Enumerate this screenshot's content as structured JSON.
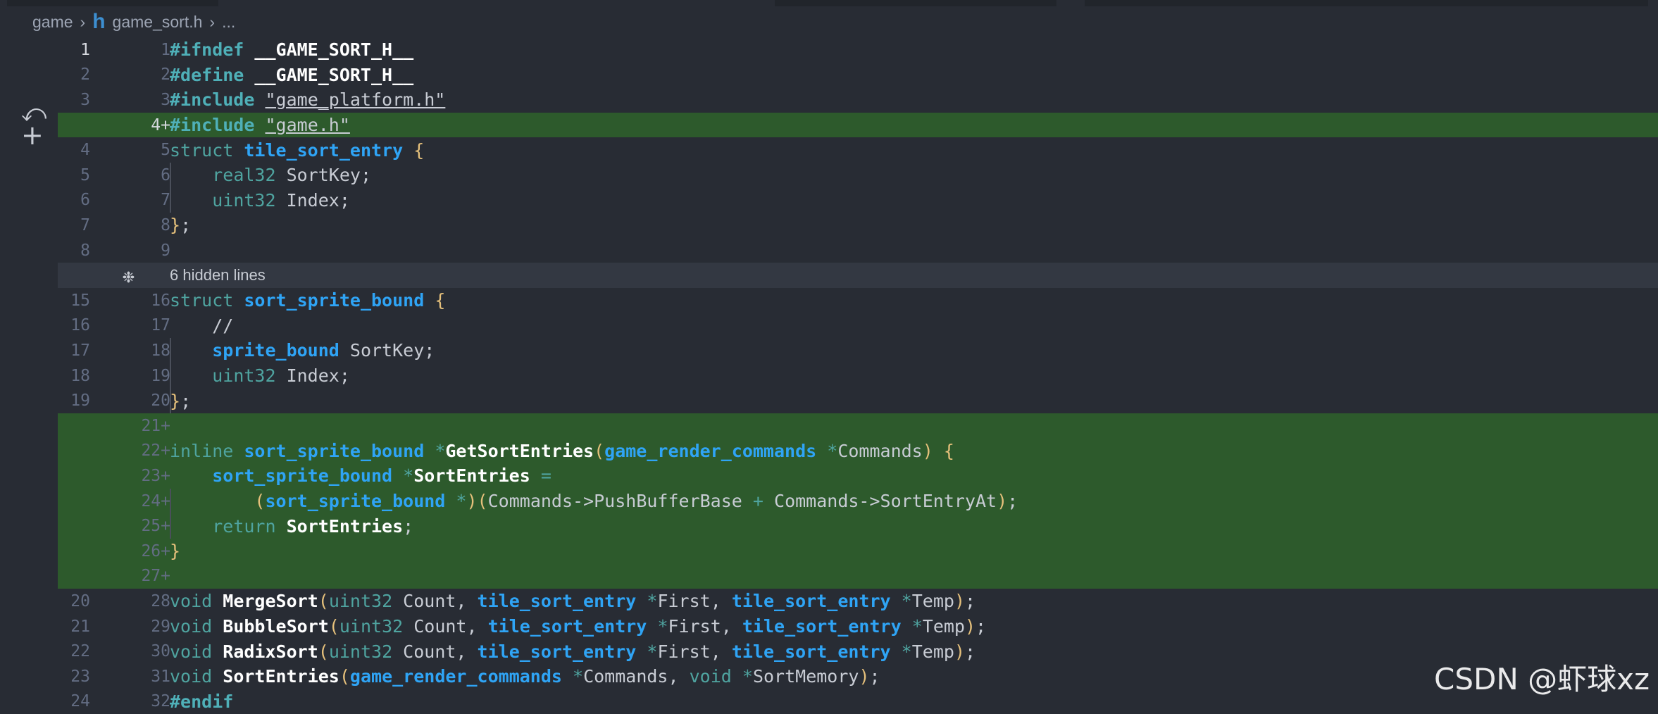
{
  "breadcrumb": {
    "folder": "game",
    "file": "game_sort.h",
    "symbol": "...",
    "file_icon_glyph": "h"
  },
  "fold": {
    "label": "6 hidden lines"
  },
  "lines": [
    {
      "old": "1",
      "new": "1",
      "added": false,
      "code": "#ifndef __GAME_SORT_H__"
    },
    {
      "old": "2",
      "new": "2",
      "added": false,
      "code": "#define __GAME_SORT_H__"
    },
    {
      "old": "3",
      "new": "3",
      "added": false,
      "code": "#include \"game_platform.h\""
    },
    {
      "old": "",
      "new": "4+",
      "added": true,
      "code": "#include \"game.h\""
    },
    {
      "old": "4",
      "new": "5",
      "added": false,
      "code": "struct tile_sort_entry {"
    },
    {
      "old": "5",
      "new": "6",
      "added": false,
      "code": "    real32 SortKey;"
    },
    {
      "old": "6",
      "new": "7",
      "added": false,
      "code": "    uint32 Index;"
    },
    {
      "old": "7",
      "new": "8",
      "added": false,
      "code": "};"
    },
    {
      "old": "8",
      "new": "9",
      "added": false,
      "code": ""
    },
    {
      "old": "15",
      "new": "16",
      "added": false,
      "code": "struct sort_sprite_bound {"
    },
    {
      "old": "16",
      "new": "17",
      "added": false,
      "code": "    //"
    },
    {
      "old": "17",
      "new": "18",
      "added": false,
      "code": "    sprite_bound SortKey;"
    },
    {
      "old": "18",
      "new": "19",
      "added": false,
      "code": "    uint32 Index;"
    },
    {
      "old": "19",
      "new": "20",
      "added": false,
      "code": "};"
    },
    {
      "old": "",
      "new": "21+",
      "added": true,
      "code": ""
    },
    {
      "old": "",
      "new": "22+",
      "added": true,
      "code": "inline sort_sprite_bound *GetSortEntries(game_render_commands *Commands) {"
    },
    {
      "old": "",
      "new": "23+",
      "added": true,
      "code": "    sort_sprite_bound *SortEntries ="
    },
    {
      "old": "",
      "new": "24+",
      "added": true,
      "code": "        (sort_sprite_bound *)(Commands->PushBufferBase + Commands->SortEntryAt);"
    },
    {
      "old": "",
      "new": "25+",
      "added": true,
      "code": "    return SortEntries;"
    },
    {
      "old": "",
      "new": "26+",
      "added": true,
      "code": "}"
    },
    {
      "old": "",
      "new": "27+",
      "added": true,
      "code": ""
    },
    {
      "old": "20",
      "new": "28",
      "added": false,
      "code": "void MergeSort(uint32 Count, tile_sort_entry *First, tile_sort_entry *Temp);"
    },
    {
      "old": "21",
      "new": "29",
      "added": false,
      "code": "void BubbleSort(uint32 Count, tile_sort_entry *First, tile_sort_entry *Temp);"
    },
    {
      "old": "22",
      "new": "30",
      "added": false,
      "code": "void RadixSort(uint32 Count, tile_sort_entry *First, tile_sort_entry *Temp);"
    },
    {
      "old": "23",
      "new": "31",
      "added": false,
      "code": "void SortEntries(game_render_commands *Commands, void *SortMemory);"
    },
    {
      "old": "24",
      "new": "32",
      "added": false,
      "code": "#endif"
    }
  ],
  "watermark": "CSDN @虾球xz",
  "colors": {
    "background": "#282c34",
    "added_line": "#2d5a2c",
    "fold_bar": "#333842",
    "user_type": "#2fa4f5",
    "keyword": "#4fa4a0",
    "bracket": "#e5c07b"
  }
}
